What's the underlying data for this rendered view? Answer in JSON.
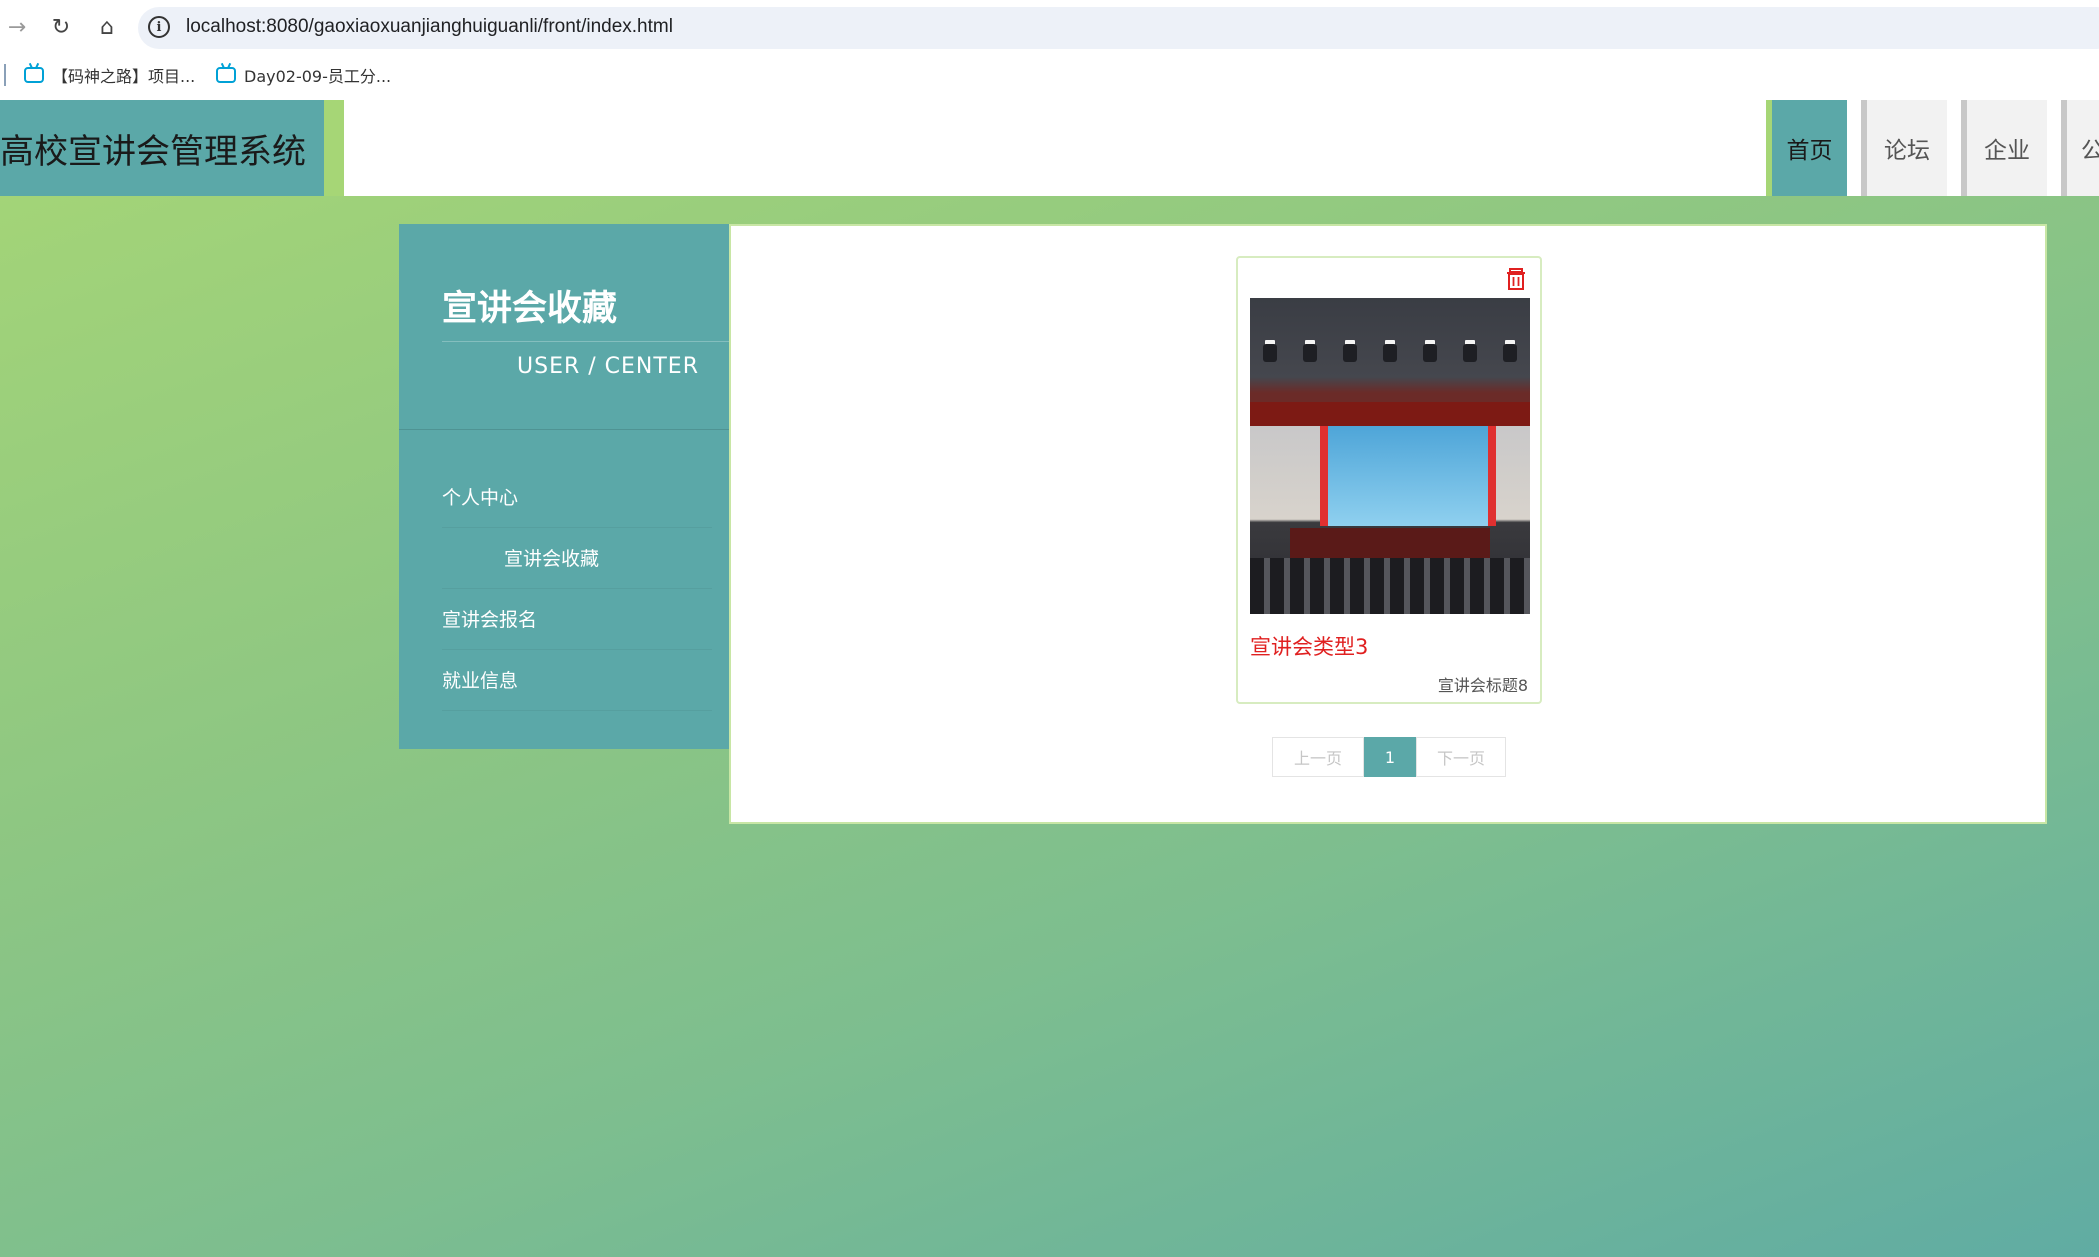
{
  "browser": {
    "url": "localhost:8080/gaoxiaoxuanjianghuiguanli/front/index.html",
    "back_icon": "arrow-right-icon",
    "reload_icon": "reload-icon",
    "home_icon": "home-icon",
    "bookmarks": [
      {
        "label": "【码神之路】项目..."
      },
      {
        "label": "Day02-09-员工分..."
      }
    ]
  },
  "header": {
    "site_title": "高校宣讲会管理系统",
    "nav": [
      {
        "label": "首页",
        "active": true
      },
      {
        "label": "论坛",
        "active": false
      },
      {
        "label": "企业",
        "active": false
      },
      {
        "label": "公",
        "active": false
      }
    ]
  },
  "sidebar": {
    "title": "宣讲会收藏",
    "subtitle": "USER / CENTER",
    "items": [
      {
        "label": "个人中心"
      },
      {
        "label": "宣讲会收藏"
      },
      {
        "label": "宣讲会报名"
      },
      {
        "label": "就业信息"
      }
    ]
  },
  "content": {
    "cards": [
      {
        "title": "宣讲会类型3",
        "subtitle": "宣讲会标题8",
        "delete_icon": "trash-icon"
      }
    ],
    "pagination": {
      "prev_label": "上一页",
      "current_page": "1",
      "next_label": "下一页"
    }
  },
  "colors": {
    "accent": "#5ba8a8",
    "accent_light": "#a6d676",
    "card_title": "#e02020"
  }
}
